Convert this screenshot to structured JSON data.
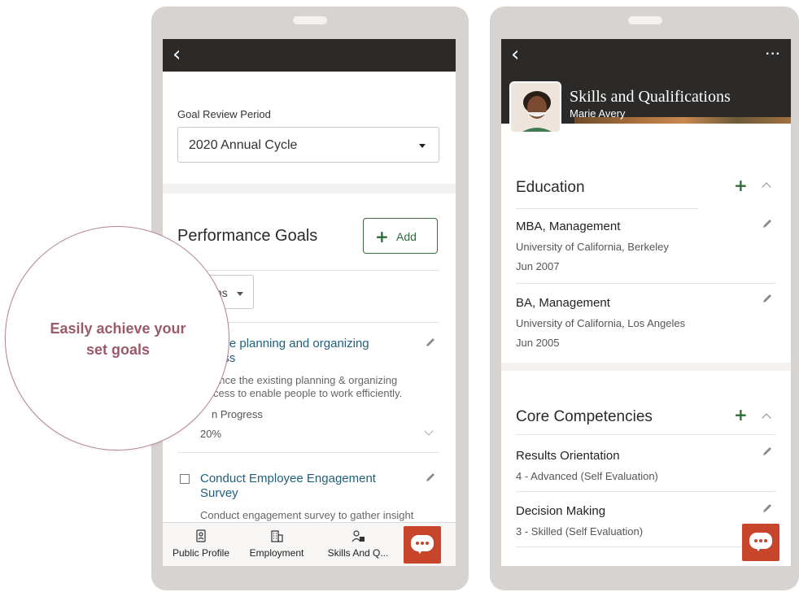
{
  "callout": {
    "text_line1": "Easily achieve your",
    "text_line2": "set goals"
  },
  "left_phone": {
    "goal_review_label": "Goal Review Period",
    "goal_review_value": "2020 Annual Cycle",
    "performance_title": "Performance Goals",
    "add_label": "Add",
    "actions_label": "ns",
    "goals": [
      {
        "title_line1": "ove planning and organizing",
        "title_line2": "ess",
        "desc_line1": "ance the existing planning & organizing",
        "desc_line2": "cess to enable people to work efficiently.",
        "status": "n Progress",
        "progress": "20%"
      },
      {
        "title_line1": "Conduct Employee Engagement",
        "title_line2": "Survey",
        "desc_line1": "Conduct engagement survey to gather insight"
      }
    ],
    "nav": [
      {
        "label": "Public Profile",
        "icon": "badge-icon"
      },
      {
        "label": "Employment",
        "icon": "building-icon"
      },
      {
        "label": "Skills And Q...",
        "icon": "person-skills-icon"
      }
    ]
  },
  "right_phone": {
    "title": "Skills and Qualifications",
    "subtitle": "Marie Avery",
    "education_title": "Education",
    "education": [
      {
        "degree": "MBA, Management",
        "school": "University of California, Berkeley",
        "date": "Jun 2007"
      },
      {
        "degree": "BA, Management",
        "school": "University of California, Los Angeles",
        "date": "Jun 2005"
      }
    ],
    "competencies_title": "Core Competencies",
    "competencies": [
      {
        "name": "Results Orientation",
        "level": "4 - Advanced (Self Evaluation)"
      },
      {
        "name": "Decision Making",
        "level": "3 - Skilled (Self Evaluation)"
      }
    ]
  },
  "colors": {
    "header_dark": "#2b2a28",
    "accent_green": "#2e6b3a",
    "link_blue": "#1f5f7a",
    "chat_orange": "#c7452a",
    "callout_text": "#9a5a6a"
  }
}
